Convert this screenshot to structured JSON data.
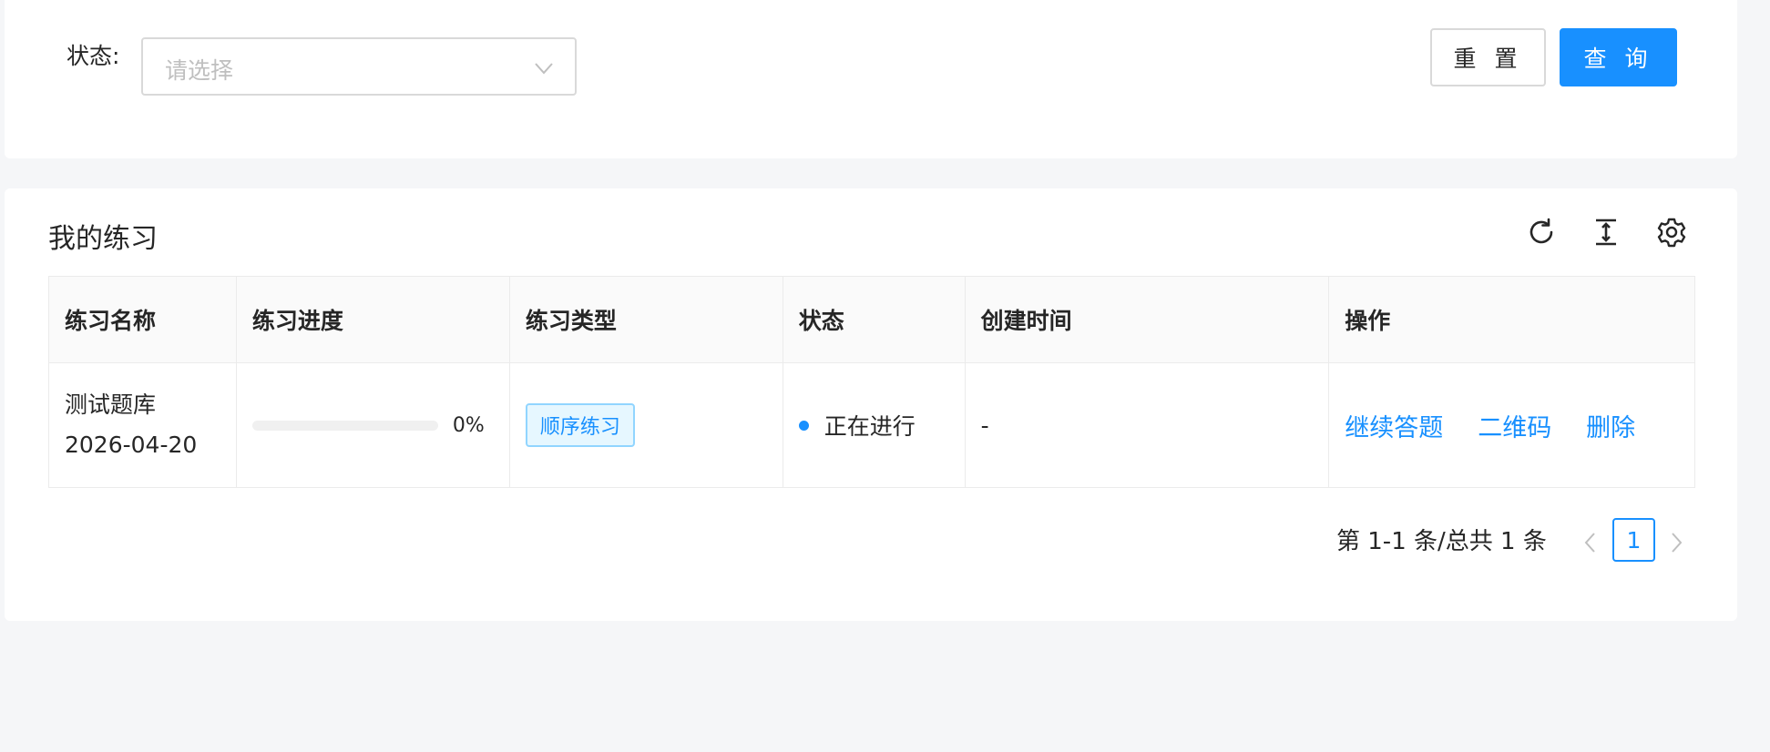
{
  "filter": {
    "status_label": "状态:",
    "status_placeholder": "请选择",
    "reset_label": "重 置",
    "query_label": "查 询"
  },
  "section": {
    "title": "我的练习"
  },
  "table": {
    "headers": [
      "练习名称",
      "练习进度",
      "练习类型",
      "状态",
      "创建时间",
      "操作"
    ],
    "rows": [
      {
        "name_line1": "测试题库",
        "name_line2": "2026-04-20",
        "progress": 0,
        "progress_text": "0%",
        "type": "顺序练习",
        "status": "正在进行",
        "created": "-",
        "actions": [
          "继续答题",
          "二维码",
          "删除"
        ]
      }
    ]
  },
  "pagination": {
    "total_text": "第 1-1 条/总共 1 条",
    "current_page": "1"
  },
  "colors": {
    "primary": "#1890ff",
    "background": "#f5f6f8"
  },
  "icons": [
    "chevron-down-icon",
    "refresh-icon",
    "density-icon",
    "settings-icon",
    "chevron-left-icon",
    "chevron-right-icon"
  ]
}
